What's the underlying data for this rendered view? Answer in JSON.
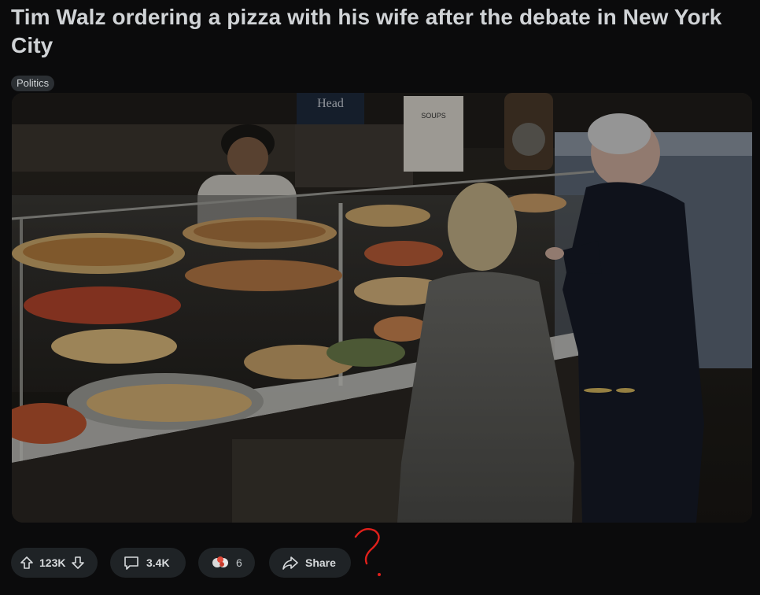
{
  "post": {
    "title": "Tim Walz ordering a pizza with his wife after the debate in New York City",
    "flair": "Politics"
  },
  "media": {
    "sign_text": "Head",
    "soups_sign": "SOUPS"
  },
  "actions": {
    "vote_count": "123K",
    "comment_count": "3.4K",
    "award_count": "6",
    "share_label": "Share"
  },
  "annotation": {
    "scribble": "?",
    "color": "#e0201b"
  }
}
